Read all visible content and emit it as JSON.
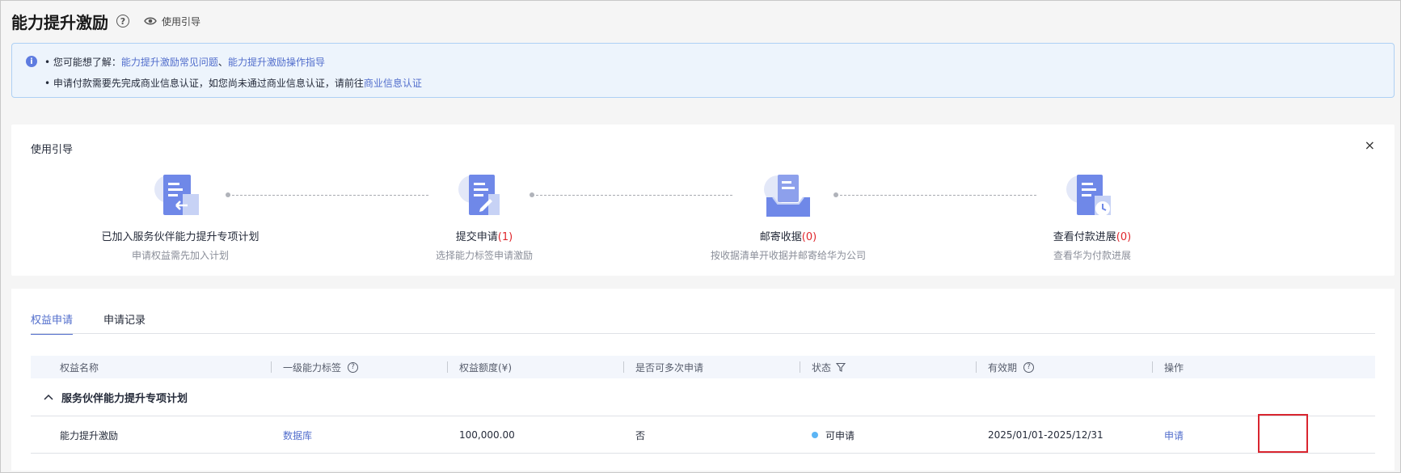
{
  "header": {
    "title": "能力提升激励",
    "help_glyph": "?",
    "guide_link": "使用引导"
  },
  "alert": {
    "icon_glyph": "i",
    "line1_prefix": "• 您可能想了解：",
    "line1_link1": "能力提升激励常见问题",
    "line1_sep": "、",
    "line1_link2": "能力提升激励操作指导",
    "line2_prefix": "• 申请付款需要先完成商业信息认证，如您尚未通过商业信息认证，请前往",
    "line2_link": "商业信息认证"
  },
  "guide": {
    "title": "使用引导",
    "close_glyph": "×",
    "steps": [
      {
        "name": "已加入服务伙伴能力提升专项计划",
        "count": "",
        "desc": "申请权益需先加入计划",
        "icon": "document-return-icon"
      },
      {
        "name": "提交申请",
        "count": "(1)",
        "desc": "选择能力标签申请激励",
        "icon": "document-edit-icon"
      },
      {
        "name": "邮寄收据",
        "count": "(0)",
        "desc": "按收据清单开收据并邮寄给华为公司",
        "icon": "mail-tray-icon"
      },
      {
        "name": "查看付款进展",
        "count": "(0)",
        "desc": "查看华为付款进展",
        "icon": "document-clock-icon"
      }
    ]
  },
  "tabs": [
    {
      "label": "权益申请",
      "active": true
    },
    {
      "label": "申请记录",
      "active": false
    }
  ],
  "table": {
    "columns": {
      "name": "权益名称",
      "tag": "一级能力标签",
      "amount": "权益额度(¥)",
      "multiple": "是否可多次申请",
      "status": "状态",
      "validity": "有效期",
      "action": "操作"
    },
    "group": "服务伙伴能力提升专项计划",
    "rows": [
      {
        "name": "能力提升激励",
        "tag": "数据库",
        "amount": "100,000.00",
        "multiple": "否",
        "status": "可申请",
        "validity": "2025/01/01-2025/12/31",
        "action": "申请"
      }
    ]
  },
  "colors": {
    "accent": "#526ecc",
    "status_dot": "#5cb5f5",
    "count_red": "#e0272d",
    "highlight_box": "#d9252f"
  }
}
